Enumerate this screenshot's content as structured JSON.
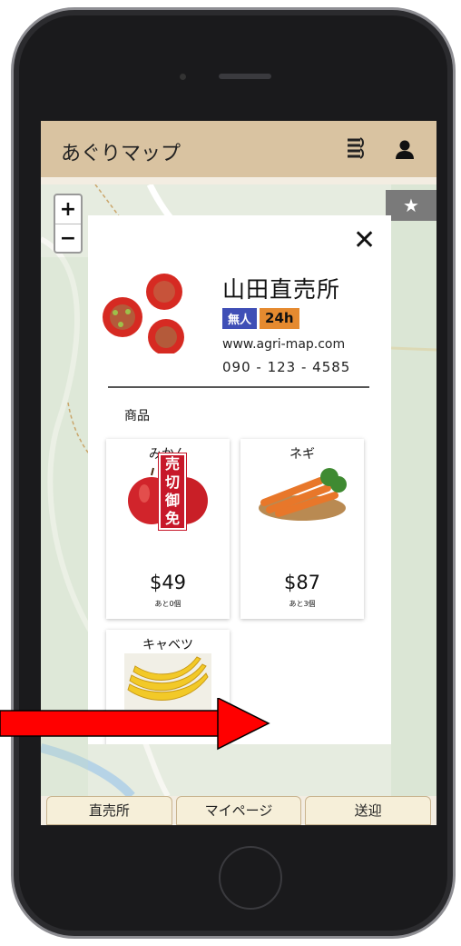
{
  "app": {
    "title": "あぐりマップ"
  },
  "map": {
    "zoom_in": "+",
    "zoom_out": "−",
    "favorites_tab_icon": "★"
  },
  "store": {
    "name": "山田直売所",
    "badges": [
      "無人",
      "24h"
    ],
    "url": "www.agri-map.com",
    "phone": "090 - 123 - 4585"
  },
  "products": {
    "section_label": "商品",
    "items": [
      {
        "name": "みかん",
        "price": "$49",
        "stock": "あと0個",
        "sold_out_label": "売切御免",
        "image": "apple-image"
      },
      {
        "name": "ネギ",
        "price": "$87",
        "stock": "あと3個",
        "image": "carrot-image"
      },
      {
        "name": "キャベツ",
        "image": "banana-image"
      }
    ]
  },
  "actions": {
    "favorite_icon": "★",
    "next_icon": "→"
  },
  "nav": [
    "直売所",
    "マイページ",
    "送迎"
  ],
  "colors": {
    "appbar": "#d9c3a1",
    "badge_unmanned": "#3f4fb6",
    "badge_24h": "#e58a2f",
    "sold_out": "#c7182a",
    "fab": "#e8a030",
    "highlight": "#ea4a4f",
    "arrow": "#ff0000"
  }
}
